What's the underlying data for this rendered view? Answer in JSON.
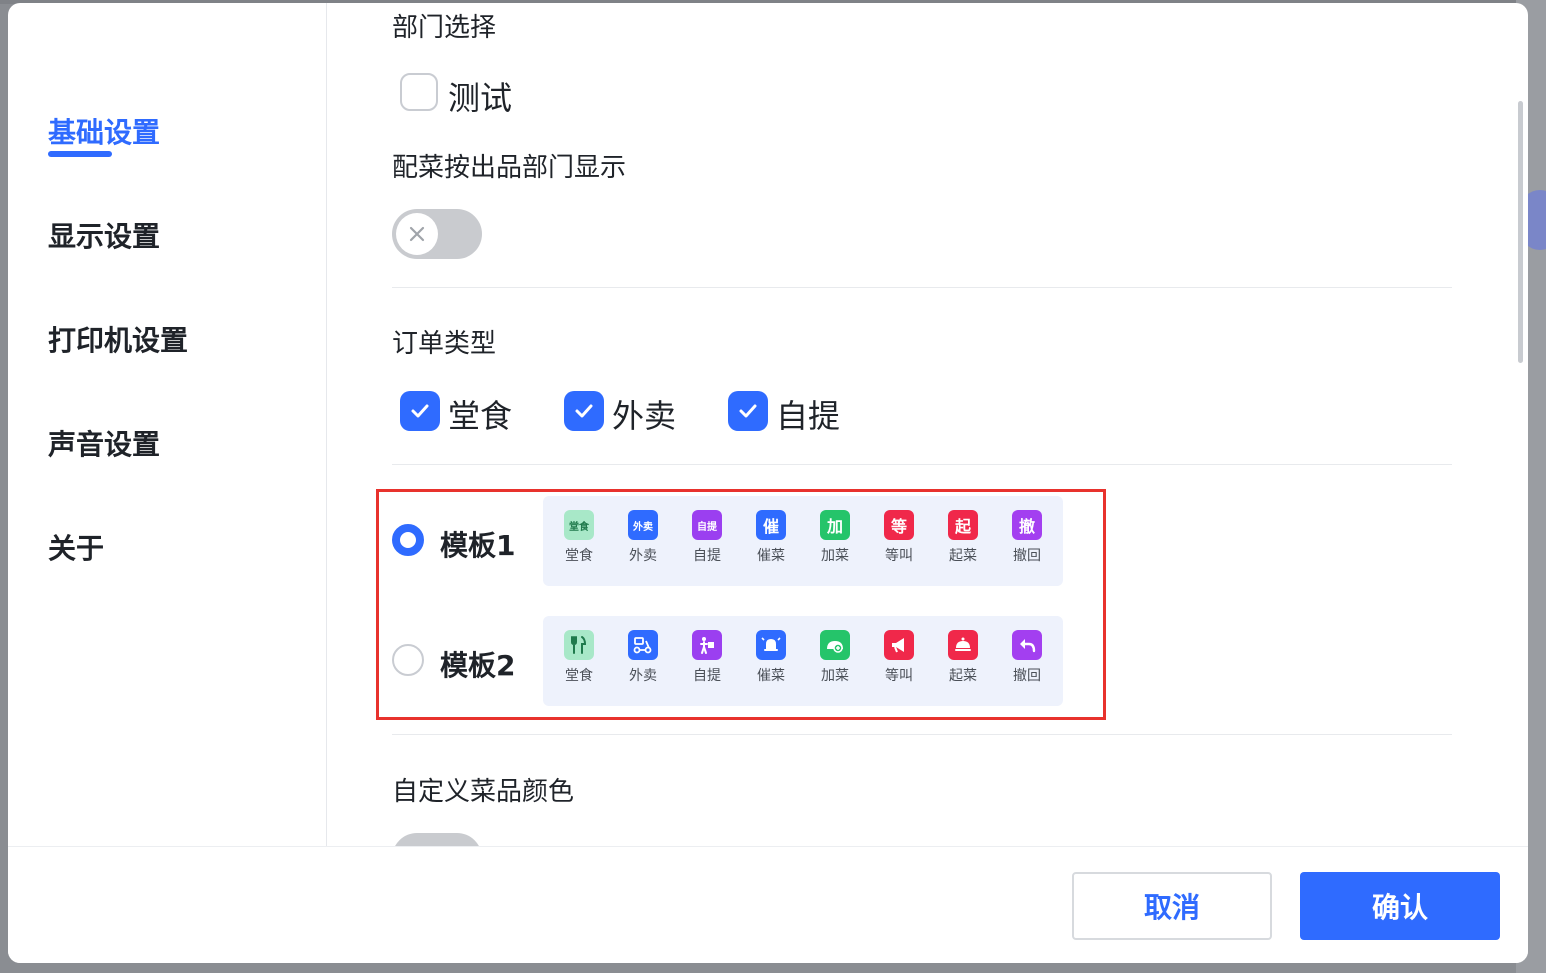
{
  "sidebar": {
    "items": [
      {
        "label": "基础设置",
        "active": true
      },
      {
        "label": "显示设置",
        "active": false
      },
      {
        "label": "打印机设置",
        "active": false
      },
      {
        "label": "声音设置",
        "active": false
      },
      {
        "label": "关于",
        "active": false
      }
    ]
  },
  "content": {
    "department_section_title": "部门选择",
    "department_option": "测试",
    "dish_by_dept_title": "配菜按出品部门显示",
    "dish_by_dept_toggle": false,
    "order_type_title": "订单类型",
    "order_types": [
      {
        "label": "堂食",
        "checked": true
      },
      {
        "label": "外卖",
        "checked": true
      },
      {
        "label": "自提",
        "checked": true
      }
    ],
    "templates": [
      {
        "label": "模板1",
        "selected": true,
        "icons": [
          {
            "glyph": "堂食",
            "caption": "堂食",
            "color": "#a8e8c8",
            "glyph_color": "#1f7a4c"
          },
          {
            "glyph": "外卖",
            "caption": "外卖",
            "color": "#2f6bff"
          },
          {
            "glyph": "自提",
            "caption": "自提",
            "color": "#9b3ff0"
          },
          {
            "glyph": "催",
            "caption": "催菜",
            "color": "#2f6bff"
          },
          {
            "glyph": "加",
            "caption": "加菜",
            "color": "#25c46a"
          },
          {
            "glyph": "等",
            "caption": "等叫",
            "color": "#f0284a"
          },
          {
            "glyph": "起",
            "caption": "起菜",
            "color": "#f0284a"
          },
          {
            "glyph": "撤",
            "caption": "撤回",
            "color": "#a33ff0"
          }
        ]
      },
      {
        "label": "模板2",
        "selected": false,
        "icons": [
          {
            "icon": "utensils-icon",
            "caption": "堂食",
            "color": "#a8e8c8",
            "glyph_color": "#1f7a4c"
          },
          {
            "icon": "scooter-icon",
            "caption": "外卖",
            "color": "#2f6bff"
          },
          {
            "icon": "pickup-icon",
            "caption": "自提",
            "color": "#9b3ff0"
          },
          {
            "icon": "bell-icon",
            "caption": "催菜",
            "color": "#2f6bff"
          },
          {
            "icon": "add-dish-icon",
            "caption": "加菜",
            "color": "#25c46a"
          },
          {
            "icon": "megaphone-icon",
            "caption": "等叫",
            "color": "#f0284a"
          },
          {
            "icon": "cloche-icon",
            "caption": "起菜",
            "color": "#f0284a"
          },
          {
            "icon": "undo-icon",
            "caption": "撤回",
            "color": "#a33ff0"
          }
        ]
      }
    ],
    "custom_color_title": "自定义菜品颜色"
  },
  "footer": {
    "cancel_label": "取消",
    "confirm_label": "确认"
  },
  "colors": {
    "accent": "#2f6bff",
    "highlight_border": "#e8322d"
  }
}
